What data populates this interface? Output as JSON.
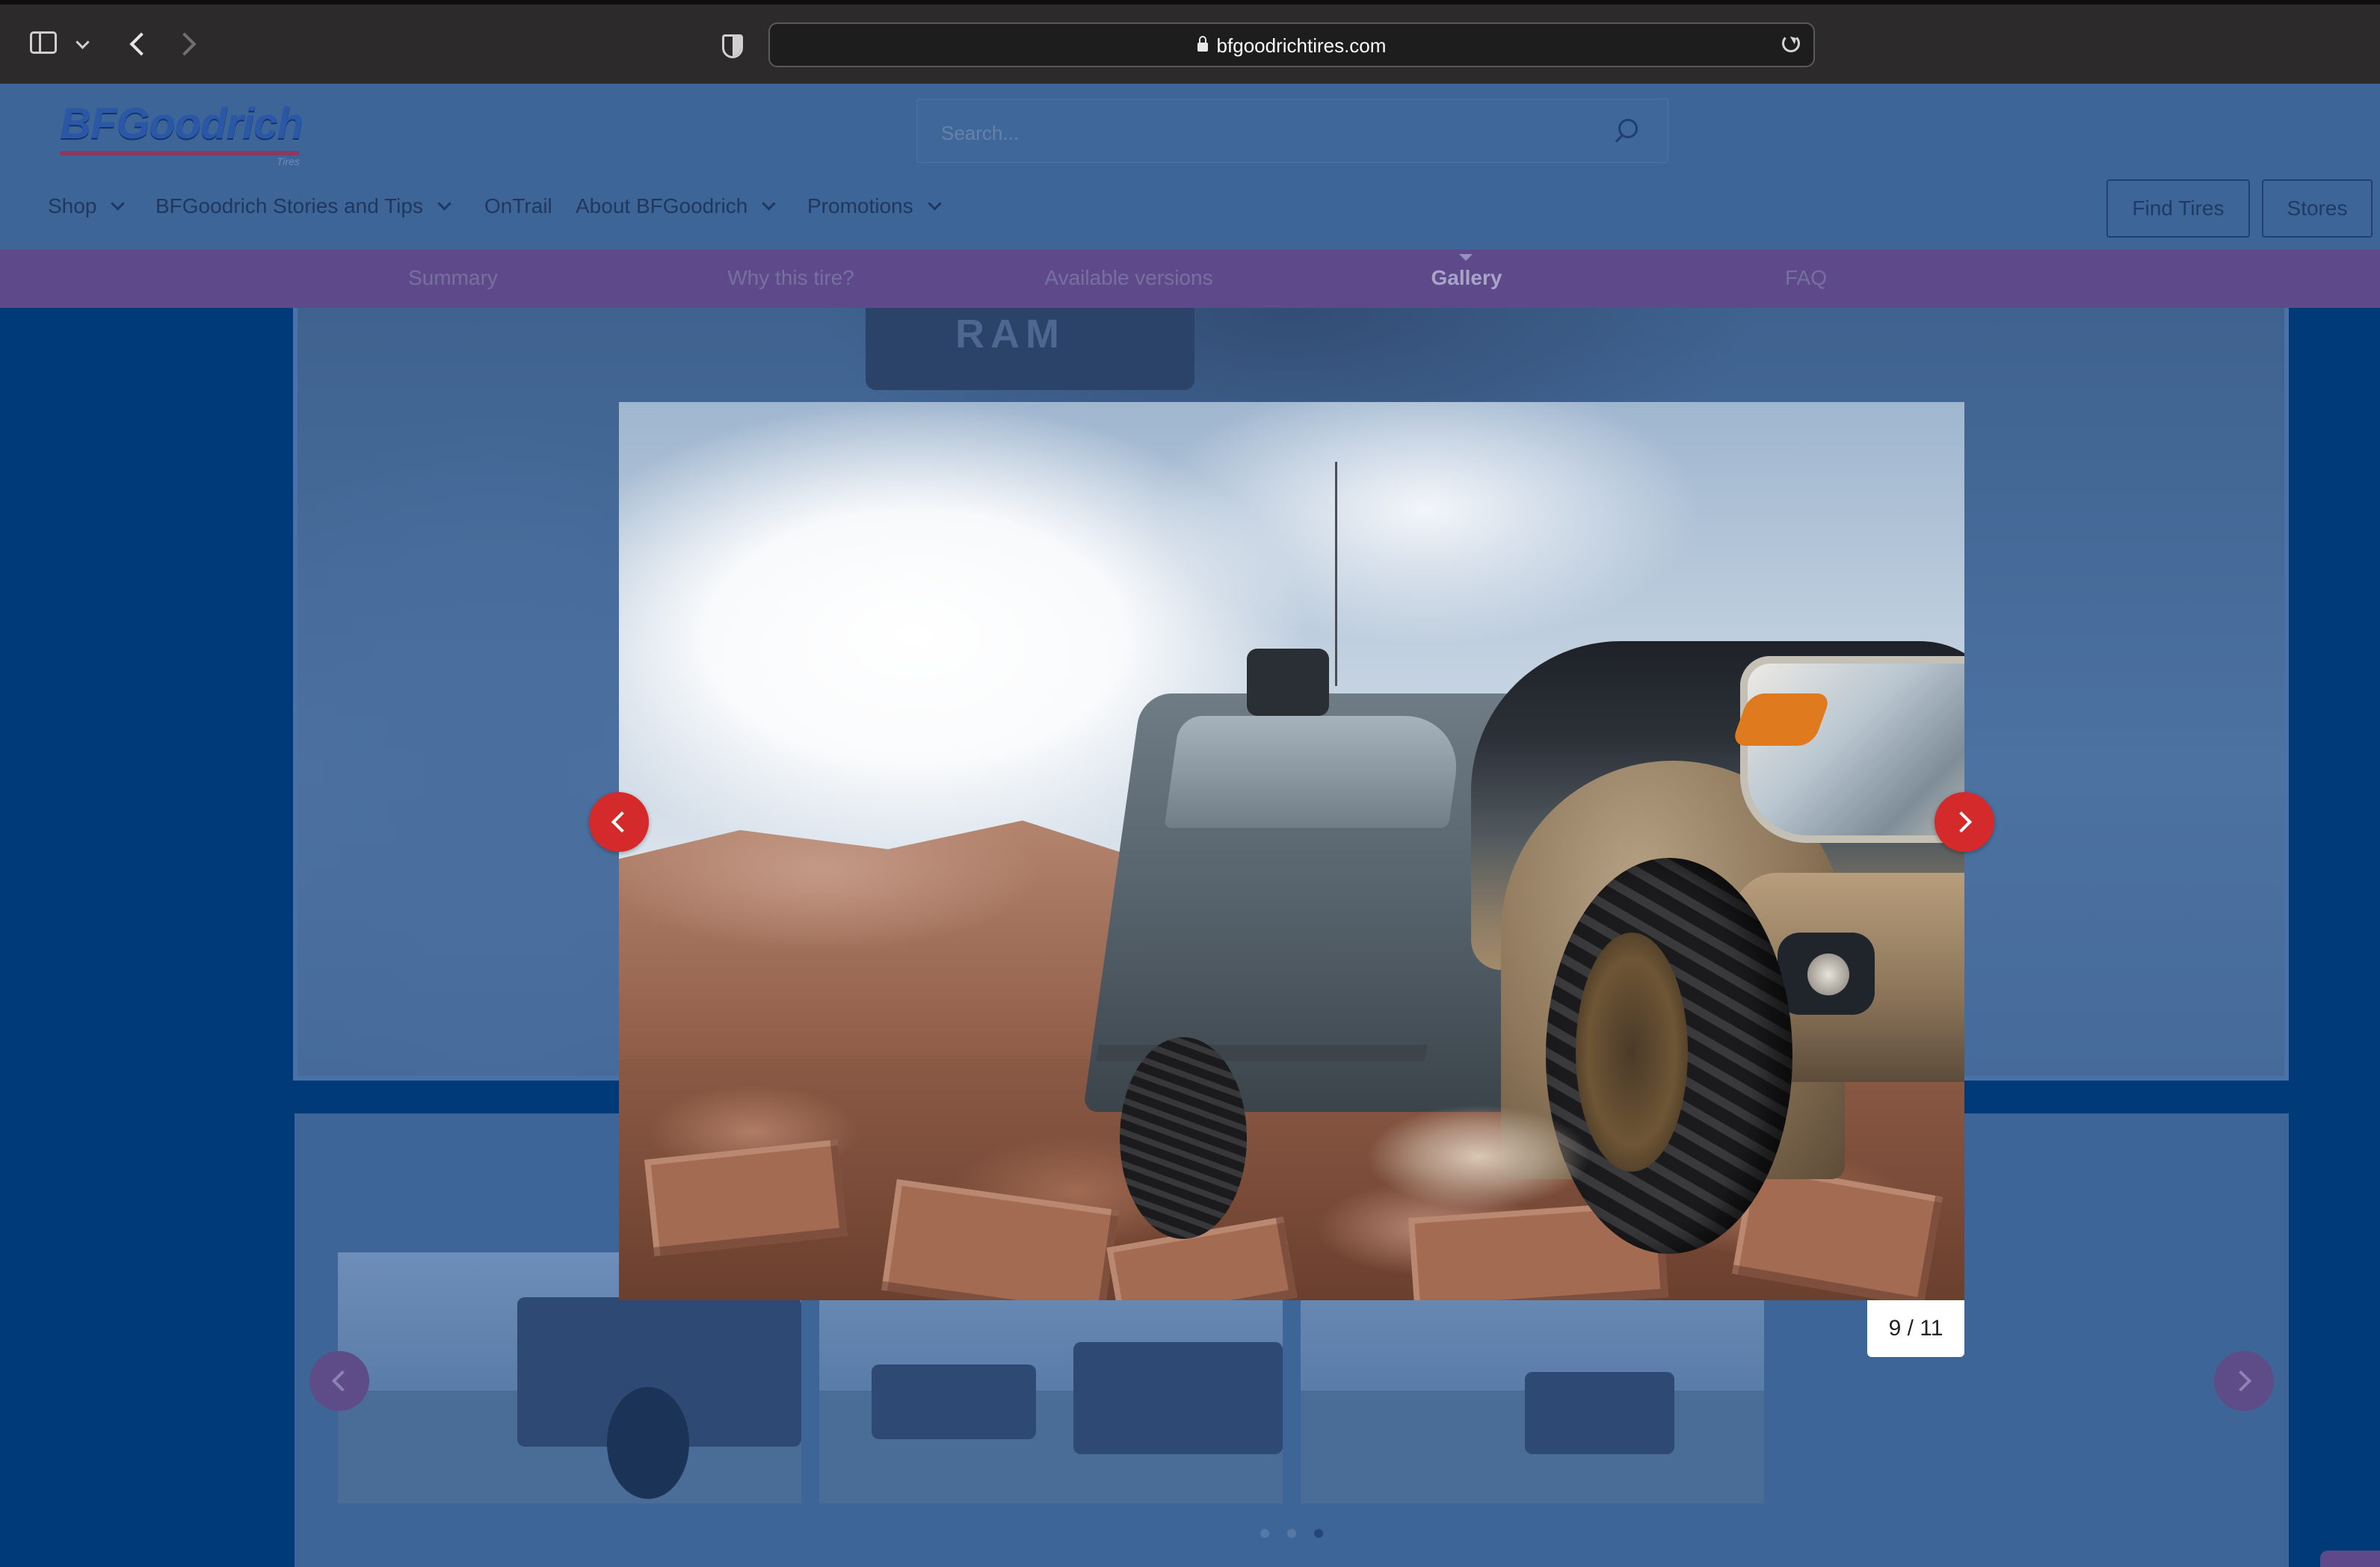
{
  "browser": {
    "url": "bfgoodrichtires.com",
    "icons": [
      "sidebar-toggle-icon",
      "chevron-down-icon",
      "back-arrow-icon",
      "forward-arrow-icon",
      "privacy-shield-icon",
      "lock-icon",
      "reload-icon"
    ]
  },
  "header": {
    "logo_text": "BFGoodrich",
    "logo_subtext": "Tires",
    "search_placeholder": "Search...",
    "nav": [
      {
        "label": "Shop",
        "has_dropdown": true
      },
      {
        "label": "BFGoodrich Stories and Tips",
        "has_dropdown": true
      },
      {
        "label": "OnTrail",
        "has_dropdown": false
      },
      {
        "label": "About BFGoodrich",
        "has_dropdown": true
      },
      {
        "label": "Promotions",
        "has_dropdown": true
      }
    ],
    "find_tires_label": "Find Tires",
    "stores_label": "Stores"
  },
  "subnav": {
    "items": [
      "Summary",
      "Why this tire?",
      "Available versions",
      "Gallery",
      "FAQ"
    ],
    "active": "Gallery"
  },
  "stage": {
    "background_text": "RAM"
  },
  "lightbox": {
    "counter": "9 / 11",
    "current": 9,
    "total": 11,
    "prev_icon": "chevron-left-icon",
    "next_icon": "chevron-right-icon",
    "accent_color": "#d42a2c"
  },
  "thumbnails": {
    "count_visible": 3,
    "active_dot": 3
  },
  "colors": {
    "overlay_blue": "#003a78",
    "subnav_purple": "#5e4a8a",
    "brand_blue": "#2a57a6"
  }
}
